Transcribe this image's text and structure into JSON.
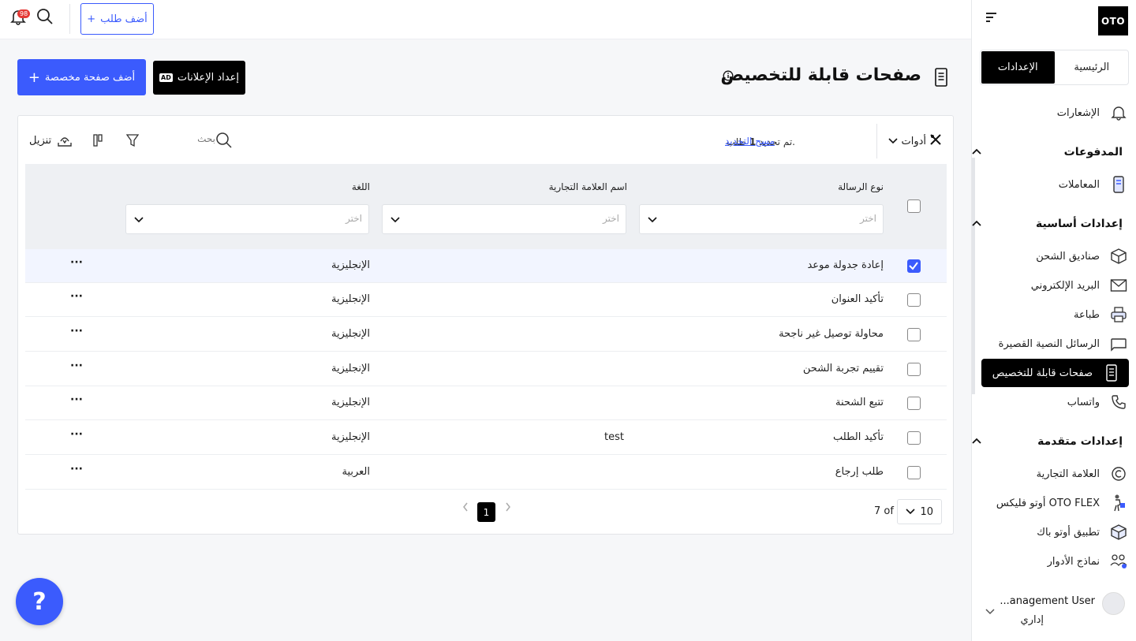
{
  "brand": {
    "logo": "OTO",
    "accent": "#3b5bfd"
  },
  "topbar": {
    "add_order": "أضف طلب",
    "notifications_count": "98"
  },
  "sidebar": {
    "tabs": [
      {
        "label": "الرئيسية"
      },
      {
        "label": "الإعدادات"
      }
    ],
    "notifications": "الإشعارات",
    "sections": {
      "payments": "المدفوعات",
      "basic": "إعدادات أساسية",
      "advanced": "إعدادات متقدمة"
    },
    "items": {
      "transactions": "المعاملات",
      "boxes": "صناديق الشحن",
      "email": "البريد الإلكتروني",
      "print": "طباعة",
      "sms": "الرسائل النصية القصيرة",
      "custom_pages": "صفحات قابلة للتخصيص",
      "whatsapp": "واتساب",
      "brand": "العلامة التجارية",
      "flex": "أوتو فليكس OTO FLEX",
      "app": "تطبيق أوتو باك",
      "roles": "نماذج الأدوار"
    },
    "user": {
      "name": "...anagement User",
      "role": "إداري"
    }
  },
  "page": {
    "title": "صفحات قابلة للتخصيص",
    "ads_button": "إعداد الإعلانات",
    "add_page_button": "أضف صفحة مخصصة"
  },
  "toolbar": {
    "tools": "أدوات",
    "selection_prefix": "تم تحديد",
    "selection_count": "1",
    "selection_suffix": "طلب.",
    "clear": "مسح التحديد",
    "search_placeholder": "بحث",
    "download": "تنزيل"
  },
  "table": {
    "columns": {
      "type": "نوع الرسالة",
      "brand": "اسم العلامة التجارية",
      "language": "اللغة"
    },
    "filter_placeholder": "اختر",
    "rows": [
      {
        "type": "إعادة جدولة موعد",
        "brand": "",
        "language": "الإنجليزية",
        "checked": true
      },
      {
        "type": "تأكيد العنوان",
        "brand": "",
        "language": "الإنجليزية",
        "checked": false
      },
      {
        "type": "محاولة توصيل غير ناجحة",
        "brand": "",
        "language": "الإنجليزية",
        "checked": false
      },
      {
        "type": "تقييم تجربة الشحن",
        "brand": "",
        "language": "الإنجليزية",
        "checked": false
      },
      {
        "type": "تتبع الشحنة",
        "brand": "",
        "language": "الإنجليزية",
        "checked": false
      },
      {
        "type": "تأكيد الطلب",
        "brand": "test",
        "language": "الإنجليزية",
        "checked": false
      },
      {
        "type": "طلب إرجاع",
        "brand": "",
        "language": "العربية",
        "checked": false
      }
    ]
  },
  "pagination": {
    "per_page": "10",
    "total": "7 of",
    "current_page": "1"
  },
  "help": "?"
}
